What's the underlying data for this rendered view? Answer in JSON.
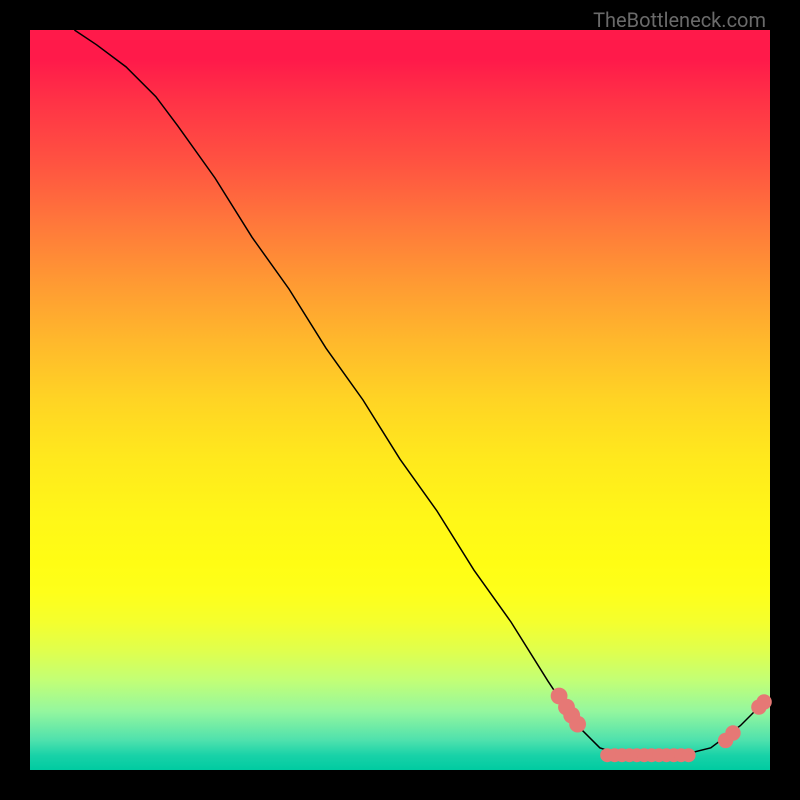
{
  "watermark": "TheBottleneck.com",
  "chart_data": {
    "type": "line",
    "title": "",
    "xlabel": "",
    "ylabel": "",
    "xlim": [
      0,
      100
    ],
    "ylim": [
      0,
      100
    ],
    "curve": [
      {
        "x": 6,
        "y": 100
      },
      {
        "x": 9,
        "y": 98
      },
      {
        "x": 13,
        "y": 95
      },
      {
        "x": 17,
        "y": 91
      },
      {
        "x": 20,
        "y": 87
      },
      {
        "x": 25,
        "y": 80
      },
      {
        "x": 30,
        "y": 72
      },
      {
        "x": 35,
        "y": 65
      },
      {
        "x": 40,
        "y": 57
      },
      {
        "x": 45,
        "y": 50
      },
      {
        "x": 50,
        "y": 42
      },
      {
        "x": 55,
        "y": 35
      },
      {
        "x": 60,
        "y": 27
      },
      {
        "x": 65,
        "y": 20
      },
      {
        "x": 70,
        "y": 12
      },
      {
        "x": 74,
        "y": 6
      },
      {
        "x": 77,
        "y": 3
      },
      {
        "x": 80,
        "y": 2
      },
      {
        "x": 84,
        "y": 2
      },
      {
        "x": 88,
        "y": 2
      },
      {
        "x": 92,
        "y": 3
      },
      {
        "x": 96,
        "y": 6
      },
      {
        "x": 99,
        "y": 9
      }
    ],
    "dots": [
      {
        "x": 71.5,
        "y": 10,
        "r": 1.2
      },
      {
        "x": 72.5,
        "y": 8.5,
        "r": 1.2
      },
      {
        "x": 73.2,
        "y": 7.4,
        "r": 1.2
      },
      {
        "x": 74.0,
        "y": 6.2,
        "r": 1.2
      },
      {
        "x": 78.0,
        "y": 2.0,
        "r": 1.0
      },
      {
        "x": 79.0,
        "y": 2.0,
        "r": 1.0
      },
      {
        "x": 80.0,
        "y": 2.0,
        "r": 1.0
      },
      {
        "x": 81.0,
        "y": 2.0,
        "r": 1.0
      },
      {
        "x": 82.0,
        "y": 2.0,
        "r": 1.0
      },
      {
        "x": 83.0,
        "y": 2.0,
        "r": 1.0
      },
      {
        "x": 84.0,
        "y": 2.0,
        "r": 1.0
      },
      {
        "x": 85.0,
        "y": 2.0,
        "r": 1.0
      },
      {
        "x": 86.0,
        "y": 2.0,
        "r": 1.0
      },
      {
        "x": 87.0,
        "y": 2.0,
        "r": 1.0
      },
      {
        "x": 88.0,
        "y": 2.0,
        "r": 1.0
      },
      {
        "x": 89.0,
        "y": 2.0,
        "r": 1.0
      },
      {
        "x": 94.0,
        "y": 4.0,
        "r": 1.1
      },
      {
        "x": 95.0,
        "y": 5.0,
        "r": 1.1
      },
      {
        "x": 98.5,
        "y": 8.5,
        "r": 1.1
      },
      {
        "x": 99.2,
        "y": 9.2,
        "r": 1.1
      }
    ],
    "dot_color": "#e67875",
    "line_color": "#000000"
  }
}
